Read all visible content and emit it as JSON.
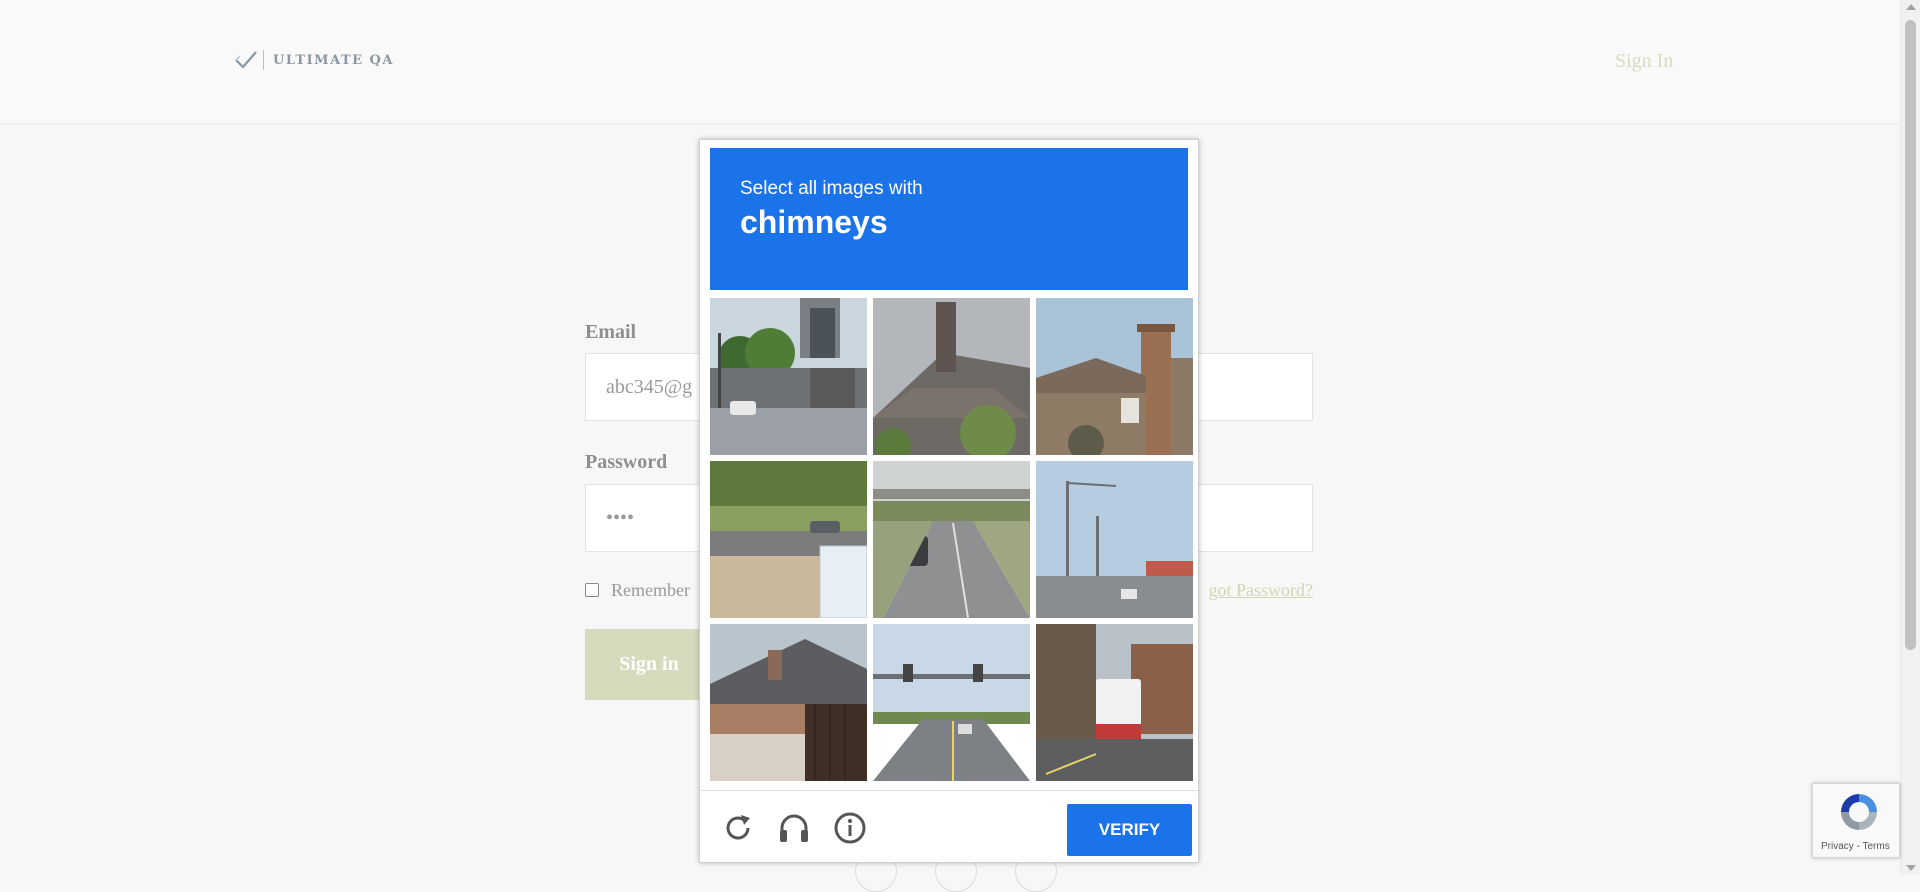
{
  "header": {
    "logo_text": "ULTIMATE QA",
    "signin_link": "Sign In"
  },
  "login_form": {
    "email_label": "Email",
    "email_value": "abc345@g",
    "password_label": "Password",
    "password_value": "••••",
    "remember_label": "Remember",
    "forgot_link": "got Password?",
    "signin_button": "Sign in"
  },
  "captcha": {
    "prompt": "Select all images with",
    "target": "chimneys",
    "tiles": [
      "street intersection with trees",
      "gray roof with chimney",
      "house with brick chimney",
      "roadside church sign",
      "highway overpass",
      "street lights intersection",
      "brick house with chimney",
      "traffic signal road",
      "street with delivery truck"
    ],
    "verify_label": "VERIFY",
    "icons": [
      "reload-icon",
      "audio-icon",
      "info-icon"
    ],
    "accent_color": "#1a73e8"
  },
  "recaptcha_badge": {
    "terms": "Privacy - Terms"
  }
}
